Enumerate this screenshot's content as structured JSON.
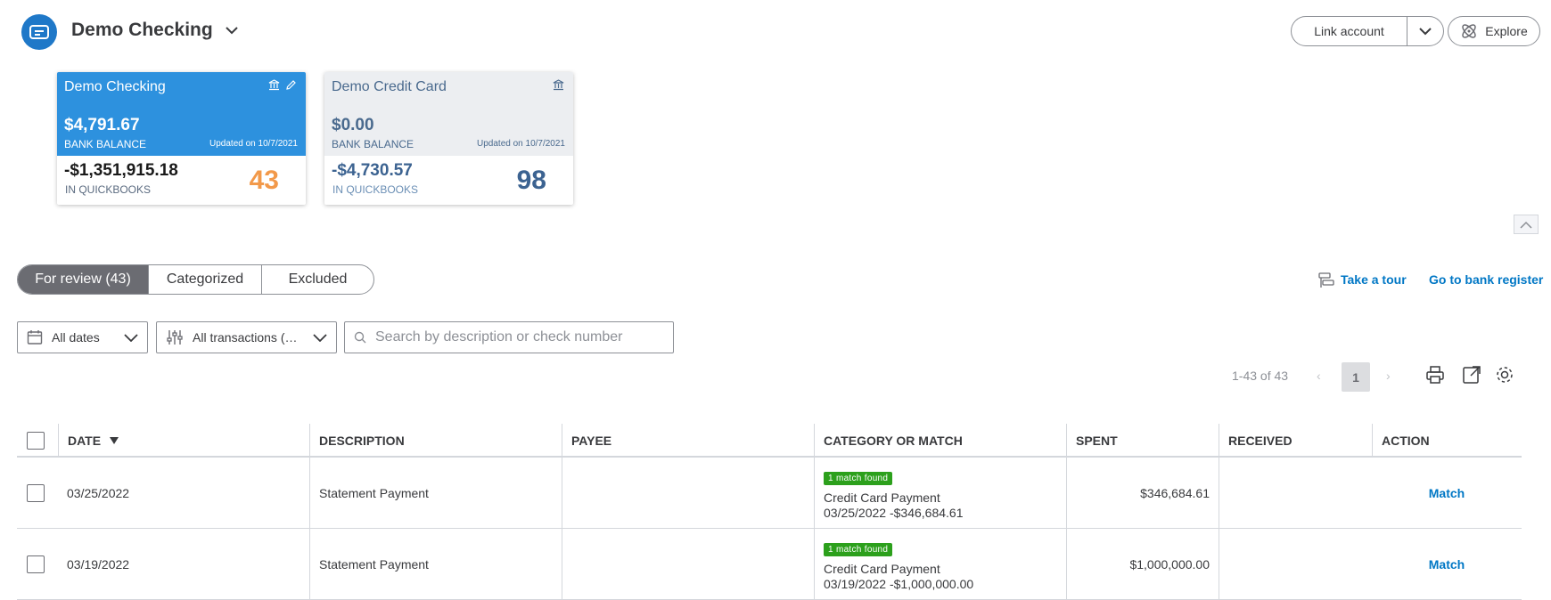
{
  "header": {
    "account_name": "Demo Checking",
    "link_account_label": "Link account",
    "explore_label": "Explore"
  },
  "cards": [
    {
      "name": "Demo Checking",
      "bank_balance": "$4,791.67",
      "bank_balance_label": "BANK BALANCE",
      "updated": "Updated on 10/7/2021",
      "qb_balance": "-$1,351,915.18",
      "qb_label": "IN QUICKBOOKS",
      "count": "43",
      "active": true
    },
    {
      "name": "Demo Credit Card",
      "bank_balance": "$0.00",
      "bank_balance_label": "BANK BALANCE",
      "updated": "Updated on 10/7/2021",
      "qb_balance": "-$4,730.57",
      "qb_label": "IN QUICKBOOKS",
      "count": "98",
      "active": false
    }
  ],
  "tabs": [
    {
      "label": "For review (43)",
      "selected": true
    },
    {
      "label": "Categorized",
      "selected": false
    },
    {
      "label": "Excluded",
      "selected": false
    }
  ],
  "links": {
    "tour": "Take a tour",
    "register": "Go to bank register"
  },
  "filters": {
    "dates": "All dates",
    "transactions": "All transactions (…",
    "search_placeholder": "Search by description or check number"
  },
  "pager": {
    "range": "1-43 of 43",
    "current_page": "1",
    "prev": "‹",
    "next": "›"
  },
  "table": {
    "headers": [
      "DATE",
      "DESCRIPTION",
      "PAYEE",
      "CATEGORY OR MATCH",
      "SPENT",
      "RECEIVED",
      "ACTION"
    ],
    "rows": [
      {
        "date": "03/25/2022",
        "description": "Statement Payment",
        "payee": "",
        "badge": "1 match found",
        "match_title": "Credit Card Payment",
        "match_detail": "03/25/2022 -$346,684.61",
        "spent": "$346,684.61",
        "received": "",
        "action": "Match"
      },
      {
        "date": "03/19/2022",
        "description": "Statement Payment",
        "payee": "",
        "badge": "1 match found",
        "match_title": "Credit Card Payment",
        "match_detail": "03/19/2022 -$1,000,000.00",
        "spent": "$1,000,000.00",
        "received": "",
        "action": "Match"
      }
    ]
  },
  "colors": {
    "primary_blue": "#2d91de",
    "link_blue": "#0077c5",
    "badge_green": "#2ca01c",
    "count_orange": "#f2994a"
  },
  "icons": [
    "bank-account-icon",
    "chevron-down-icon",
    "explore-icon",
    "bank-icon",
    "pencil-icon",
    "chevron-up-icon",
    "tour-icon",
    "calendar-icon",
    "sliders-icon",
    "search-icon",
    "print-icon",
    "export-icon",
    "gear-icon",
    "sort-down-icon"
  ]
}
